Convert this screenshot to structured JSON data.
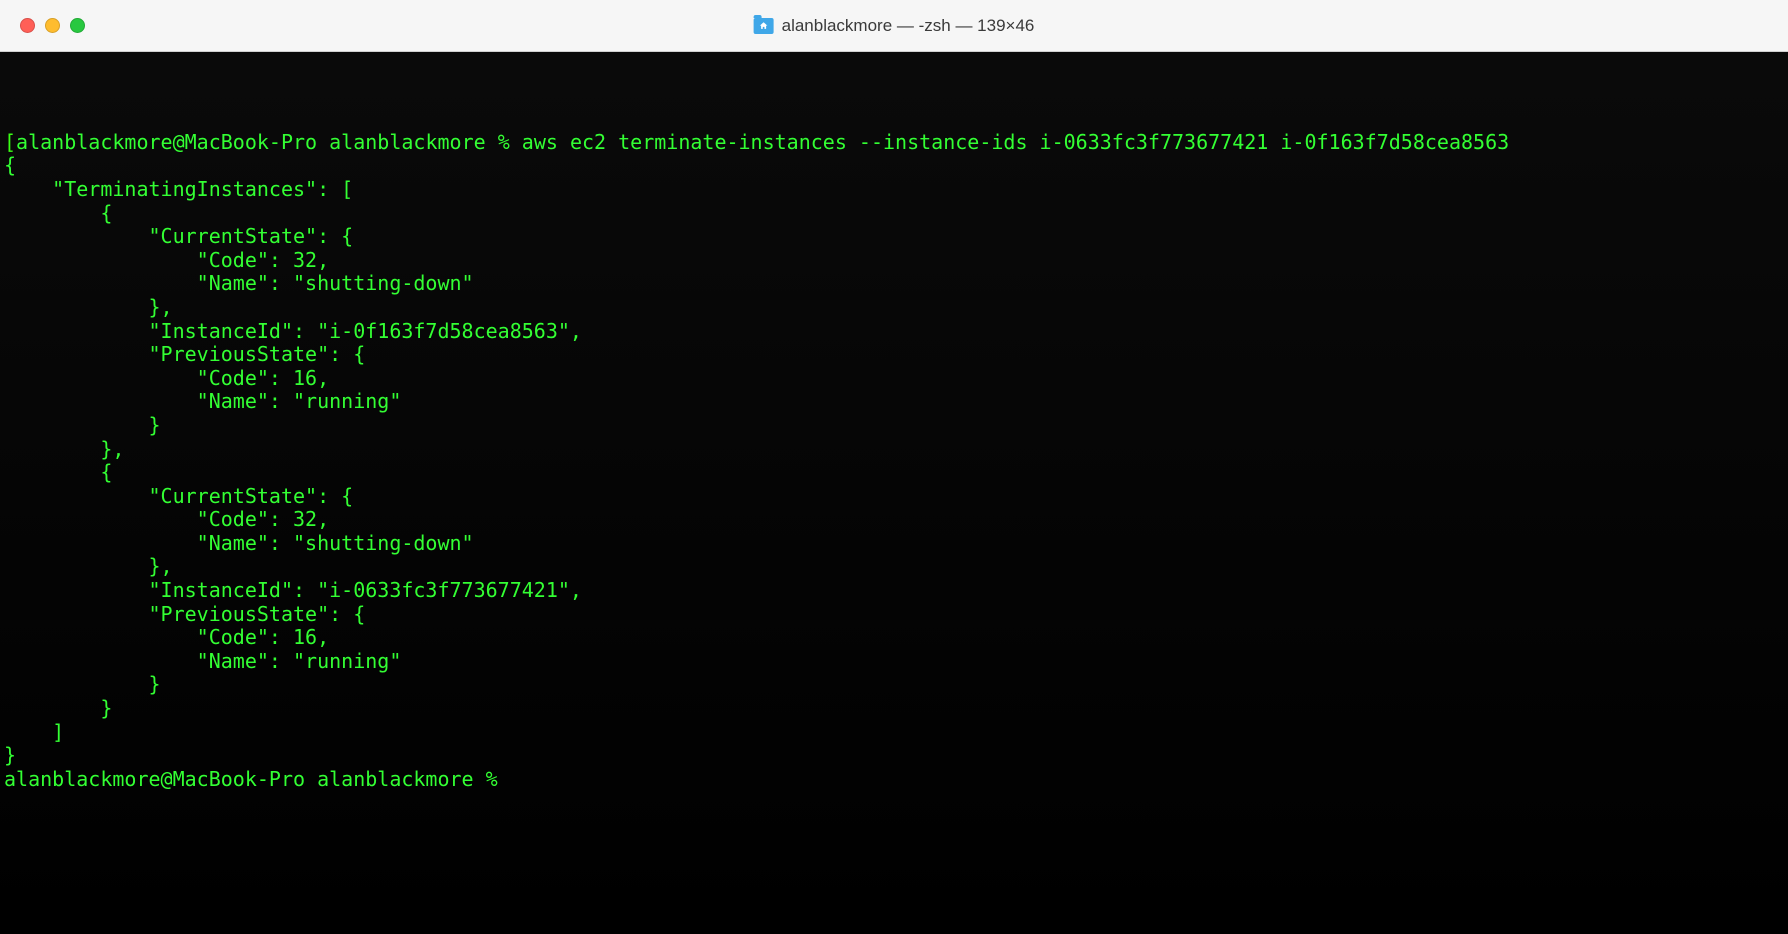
{
  "window": {
    "title": "alanblackmore — -zsh — 139×46"
  },
  "terminal": {
    "prompt": "alanblackmore@MacBook-Pro alanblackmore %",
    "command": "aws ec2 terminate-instances --instance-ids i-0633fc3f773677421 i-0f163f7d58cea8563",
    "output": {
      "TerminatingInstances": [
        {
          "CurrentState": {
            "Code": 32,
            "Name": "shutting-down"
          },
          "InstanceId": "i-0f163f7d58cea8563",
          "PreviousState": {
            "Code": 16,
            "Name": "running"
          }
        },
        {
          "CurrentState": {
            "Code": 32,
            "Name": "shutting-down"
          },
          "InstanceId": "i-0633fc3f773677421",
          "PreviousState": {
            "Code": 16,
            "Name": "running"
          }
        }
      ]
    },
    "rendered_output_line01": "{",
    "rendered_output_line02": "    \"TerminatingInstances\": [",
    "rendered_output_line03": "        {",
    "rendered_output_line04": "            \"CurrentState\": {",
    "rendered_output_line05": "                \"Code\": 32,",
    "rendered_output_line06": "                \"Name\": \"shutting-down\"",
    "rendered_output_line07": "            },",
    "rendered_output_line08": "            \"InstanceId\": \"i-0f163f7d58cea8563\",",
    "rendered_output_line09": "            \"PreviousState\": {",
    "rendered_output_line10": "                \"Code\": 16,",
    "rendered_output_line11": "                \"Name\": \"running\"",
    "rendered_output_line12": "            }",
    "rendered_output_line13": "        },",
    "rendered_output_line14": "        {",
    "rendered_output_line15": "            \"CurrentState\": {",
    "rendered_output_line16": "                \"Code\": 32,",
    "rendered_output_line17": "                \"Name\": \"shutting-down\"",
    "rendered_output_line18": "            },",
    "rendered_output_line19": "            \"InstanceId\": \"i-0633fc3f773677421\",",
    "rendered_output_line20": "            \"PreviousState\": {",
    "rendered_output_line21": "                \"Code\": 16,",
    "rendered_output_line22": "                \"Name\": \"running\"",
    "rendered_output_line23": "            }",
    "rendered_output_line24": "        }",
    "rendered_output_line25": "    ]",
    "rendered_output_line26": "}"
  }
}
